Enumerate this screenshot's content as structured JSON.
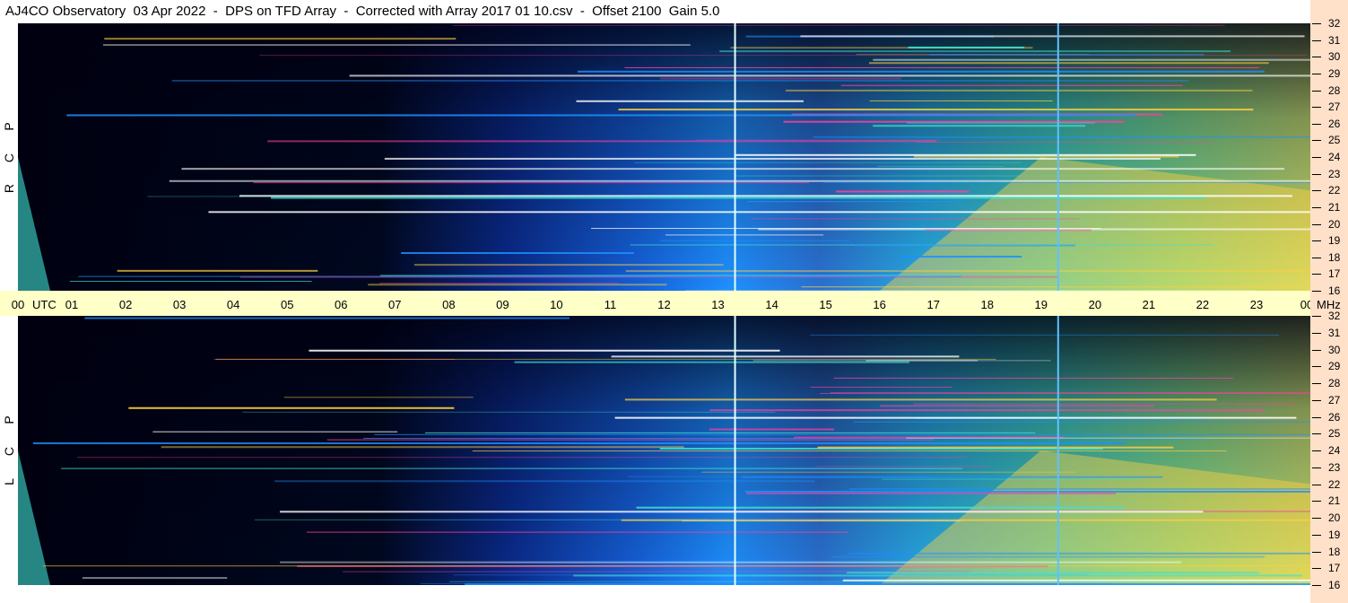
{
  "title": "AJ4CO Observatory  03 Apr 2022  -  DPS on TFD Array  -  Corrected with Array 2017 01 10.csv  -  Offset 2100  Gain 5.0",
  "chart_data": [
    {
      "type": "heatmap",
      "panel": "top",
      "polarization_label": [
        "R",
        "C",
        "P"
      ],
      "x_unit": "UTC",
      "x_ticks": [
        "00",
        "01",
        "02",
        "03",
        "04",
        "05",
        "06",
        "07",
        "08",
        "09",
        "10",
        "11",
        "12",
        "13",
        "14",
        "15",
        "16",
        "17",
        "18",
        "19",
        "20",
        "21",
        "22",
        "23",
        "00"
      ],
      "y_unit": "MHz",
      "y_ticks": [
        16,
        17,
        18,
        19,
        20,
        21,
        22,
        23,
        24,
        25,
        26,
        27,
        28,
        29,
        30,
        31,
        32
      ],
      "y_range": [
        16,
        32
      ],
      "x_range_hours": [
        0,
        24
      ],
      "grid": false
    },
    {
      "type": "heatmap",
      "panel": "bottom",
      "polarization_label": [
        "L",
        "C",
        "P"
      ],
      "x_unit": "UTC",
      "x_ticks": [
        "00",
        "01",
        "02",
        "03",
        "04",
        "05",
        "06",
        "07",
        "08",
        "09",
        "10",
        "11",
        "12",
        "13",
        "14",
        "15",
        "16",
        "17",
        "18",
        "19",
        "20",
        "21",
        "22",
        "23",
        "00"
      ],
      "y_unit": "MHz",
      "y_ticks": [
        16,
        17,
        18,
        19,
        20,
        21,
        22,
        23,
        24,
        25,
        26,
        27,
        28,
        29,
        30,
        31,
        32
      ],
      "y_range": [
        16,
        32
      ],
      "x_range_hours": [
        0,
        24
      ],
      "grid": false
    }
  ],
  "colors": {
    "background_dark": "#00001a",
    "low": "#0a1a8a",
    "mid": "#1e90ff",
    "high": "#40e0d0",
    "peak": "#ffd040",
    "hot": "#ff40a0",
    "utc_strip": "#ffffc8",
    "freq_axis": "#ffe0c8"
  }
}
